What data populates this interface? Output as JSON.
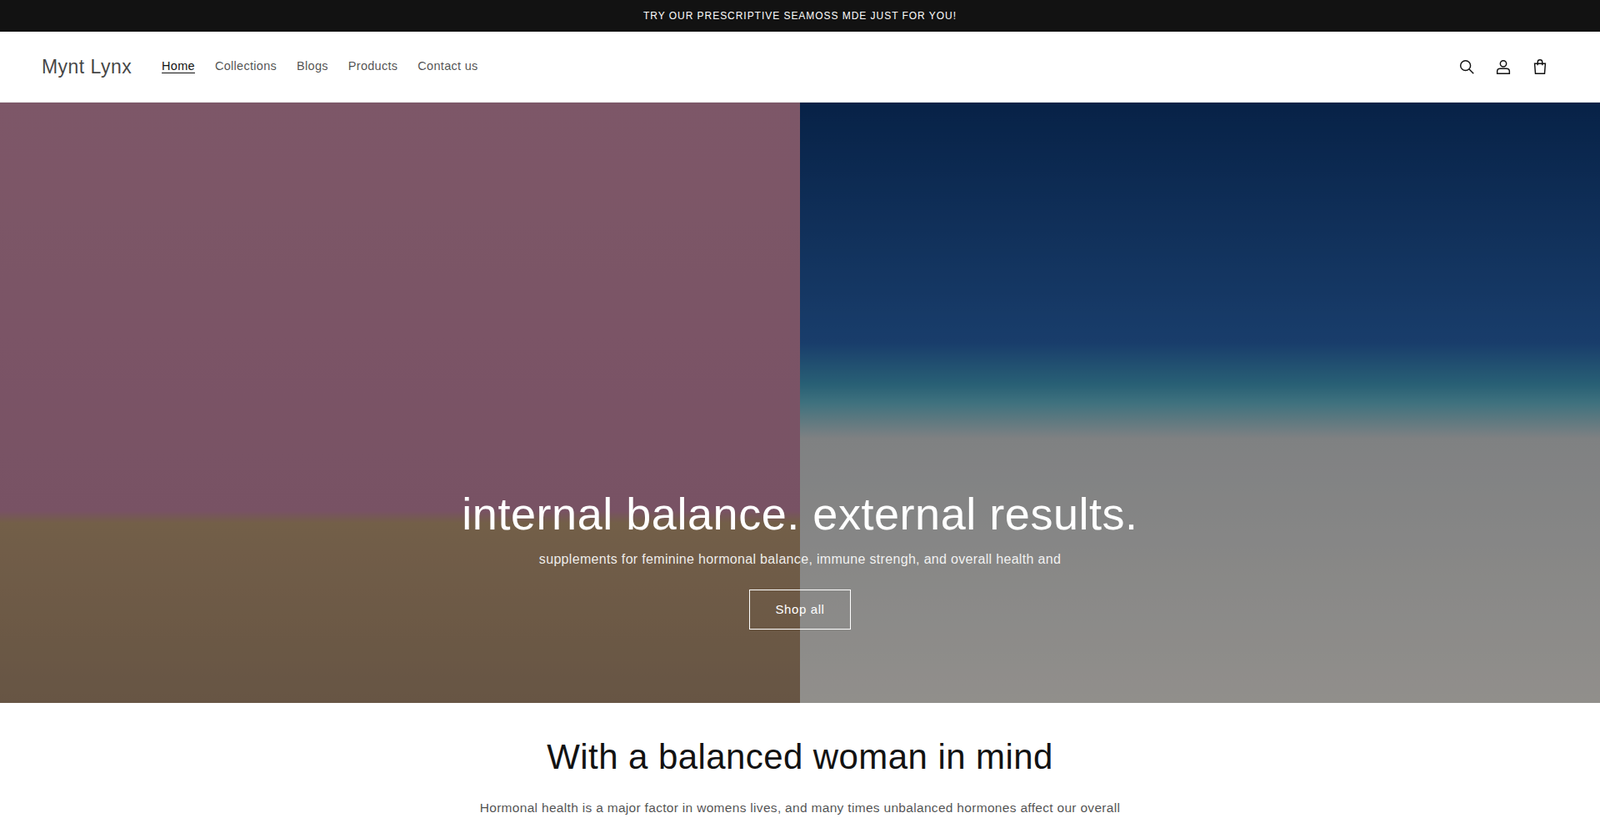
{
  "announcement": "TRY OUR PRESCRIPTIVE SEAMOSS MDE JUST FOR YOU!",
  "header": {
    "logo": "Mynt Lynx",
    "nav": [
      {
        "label": "Home",
        "selected": true
      },
      {
        "label": "Collections",
        "selected": false
      },
      {
        "label": "Blogs",
        "selected": false
      },
      {
        "label": "Products",
        "selected": false
      },
      {
        "label": "Contact us",
        "selected": false
      }
    ]
  },
  "hero": {
    "title": "internal balance. external results.",
    "subtitle": "supplements for feminine hormonal balance, immune strengh, and overall health and",
    "button": "Shop all"
  },
  "intro": {
    "title": "With a balanced woman in mind",
    "text": "Hormonal health is a major factor in womens lives, and many times unbalanced hormones affect our overall"
  }
}
